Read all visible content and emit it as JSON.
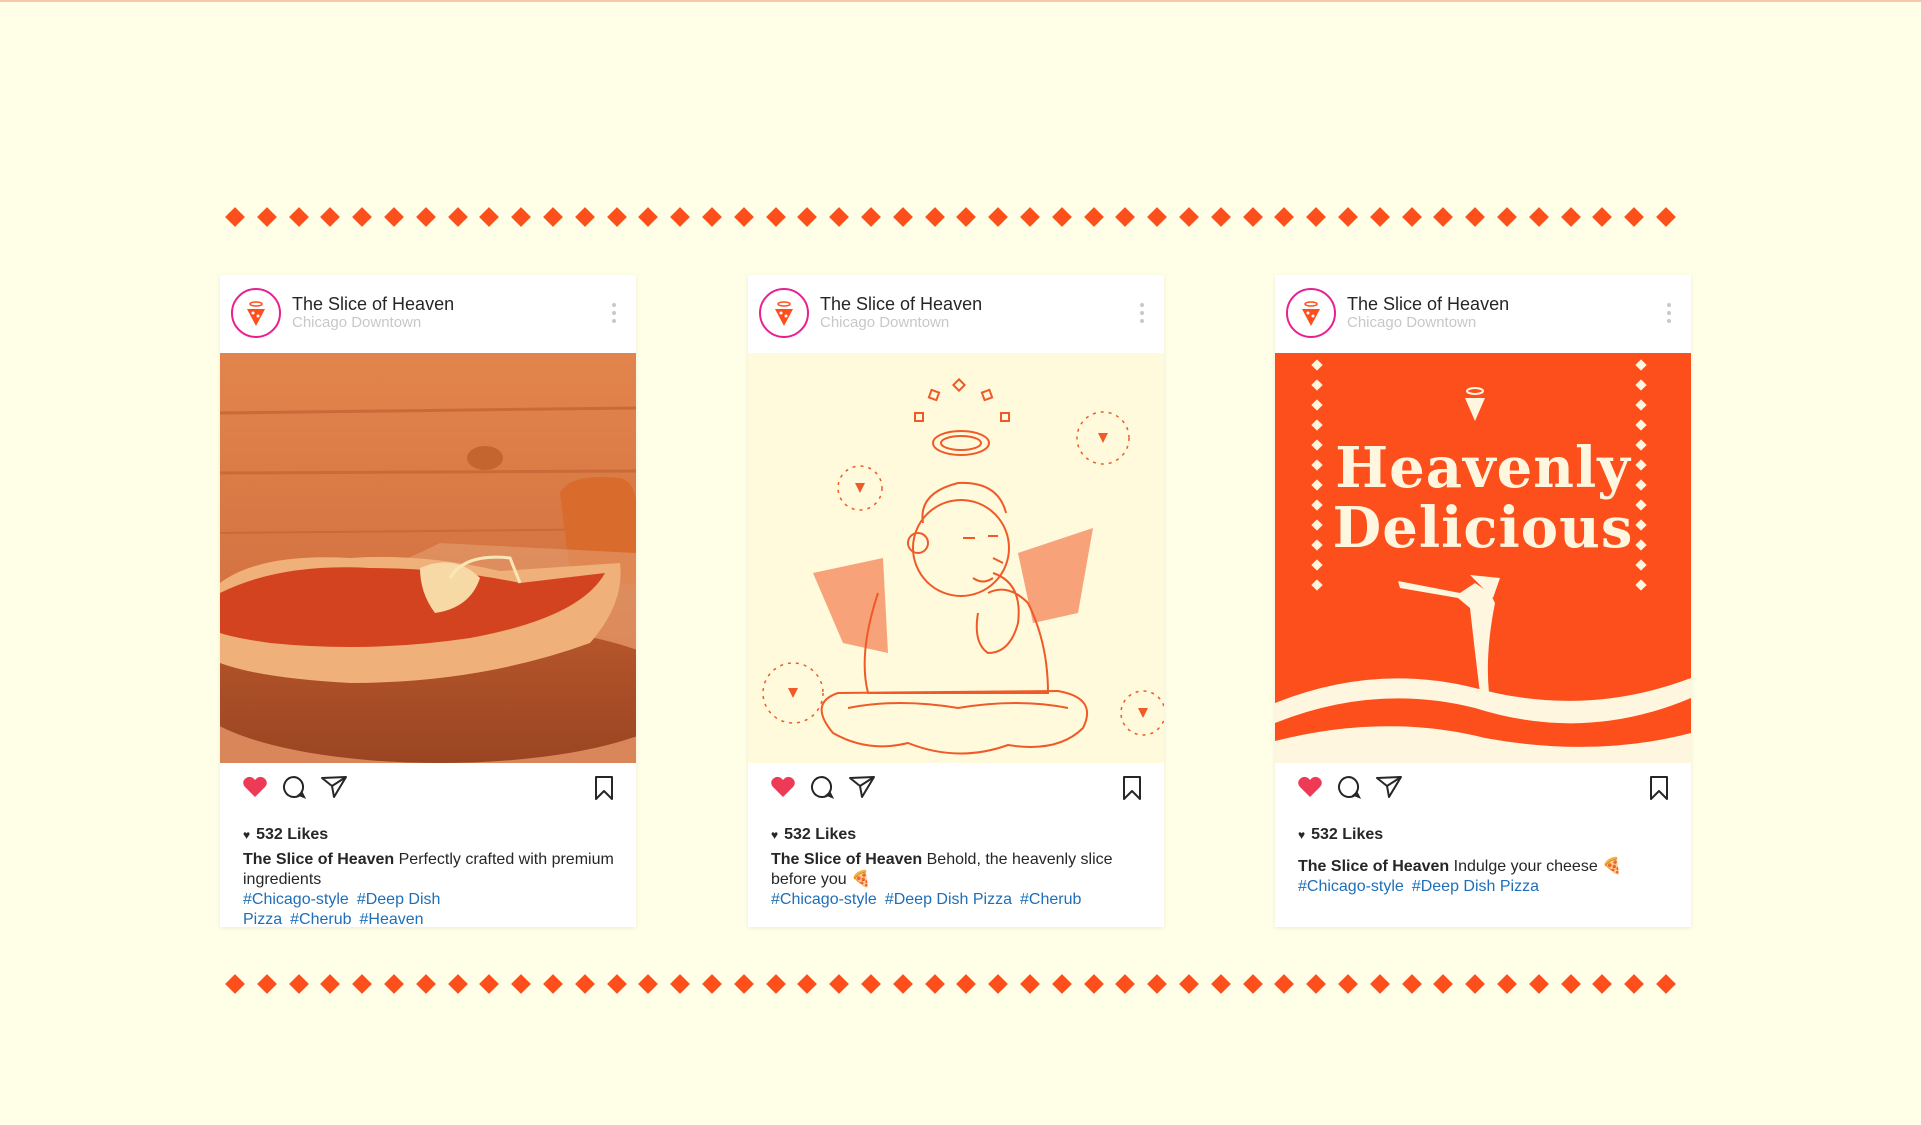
{
  "colors": {
    "background": "#fffee6",
    "accent": "#fc4f1c",
    "avatar_ring": "#e8218f",
    "like_red": "#ed3a57",
    "hashtag_blue": "#1e6fb8"
  },
  "icons": [
    "more-vertical-icon",
    "heart-icon",
    "comment-icon",
    "share-icon",
    "bookmark-icon",
    "mini-heart-icon",
    "pizza-slice-icon"
  ],
  "posts": [
    {
      "account": "The Slice of Heaven",
      "location": "Chicago Downtown",
      "likes": "532 Likes",
      "caption_user": "The Slice of Heaven",
      "caption_text": "Perfectly crafted with premium ingredients",
      "hashtags": [
        "#Chicago-style",
        "#Deep Dish Pizza",
        "#Cherub",
        "#Heaven"
      ]
    },
    {
      "account": "The Slice of Heaven",
      "location": "Chicago Downtown",
      "likes": "532 Likes",
      "caption_user": "The Slice of Heaven",
      "caption_text": "Behold, the heavenly slice before you 🍕",
      "hashtags": [
        "#Chicago-style",
        "#Deep Dish Pizza",
        "#Cherub"
      ]
    },
    {
      "account": "The Slice of Heaven",
      "location": "Chicago Downtown",
      "likes": "532 Likes",
      "caption_user": "The Slice of Heaven",
      "caption_text": "Indulge your cheese 🍕",
      "hashtags": [
        "#Chicago-style",
        "#Deep Dish Pizza"
      ],
      "headline_line1": "Heavenly",
      "headline_line2": "Delicious"
    }
  ]
}
